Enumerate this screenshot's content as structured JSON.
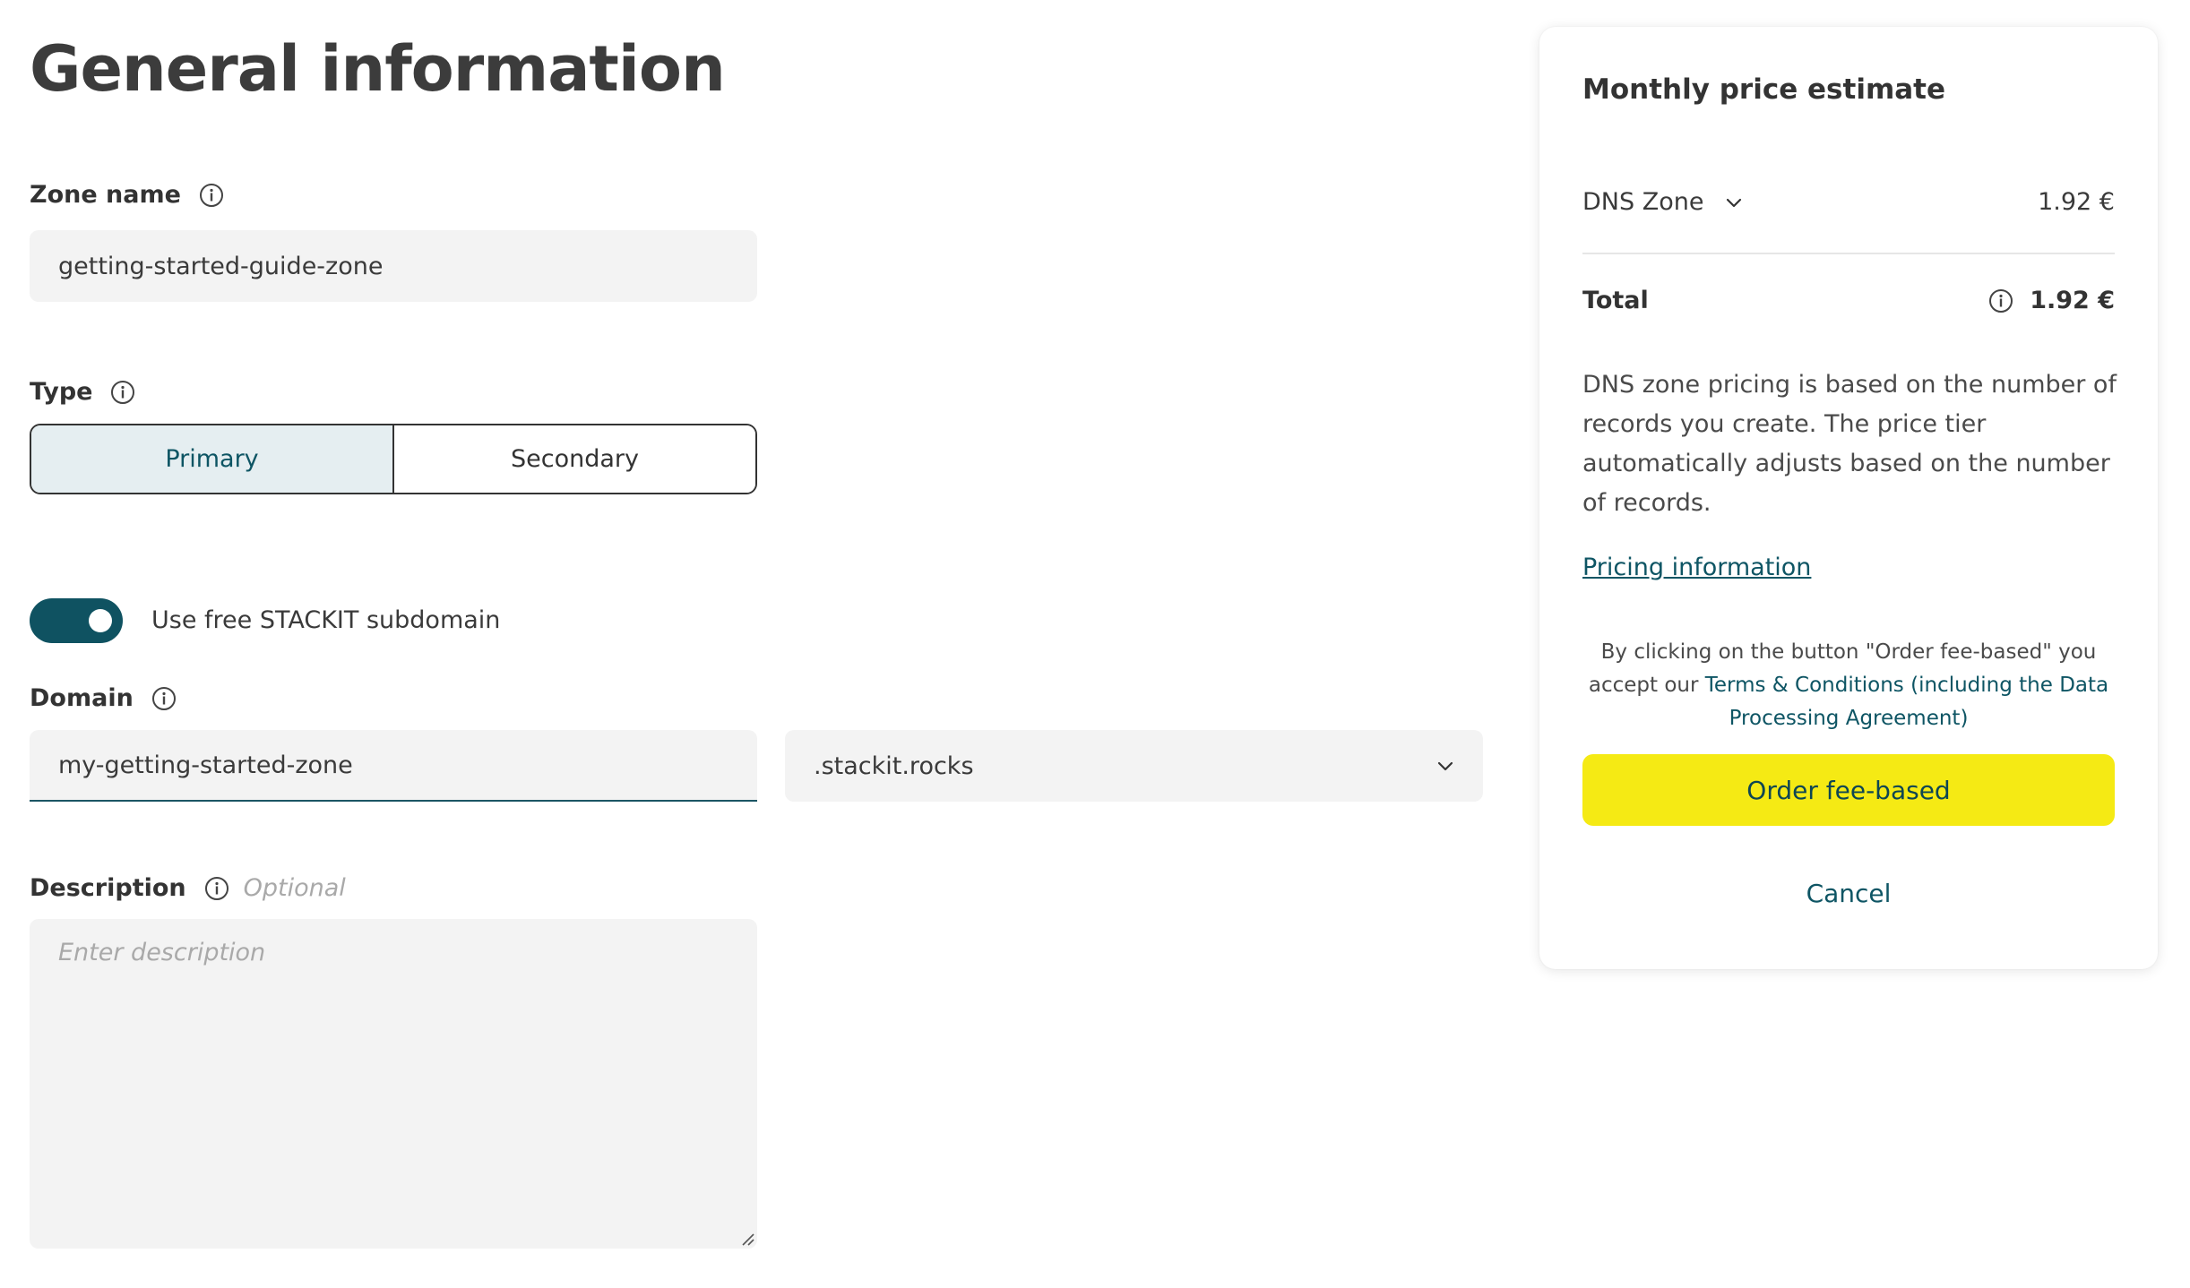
{
  "page": {
    "title": "General information"
  },
  "form": {
    "zone_name": {
      "label": "Zone name",
      "value": "getting-started-guide-zone"
    },
    "type": {
      "label": "Type",
      "options": [
        "Primary",
        "Secondary"
      ],
      "selected": "Primary"
    },
    "subdomain_toggle": {
      "label": "Use free STACKIT subdomain",
      "on": true
    },
    "domain": {
      "label": "Domain",
      "value": "my-getting-started-zone",
      "suffix": ".stackit.rocks"
    },
    "description": {
      "label": "Description",
      "optional_hint": "Optional",
      "placeholder": "Enter description"
    }
  },
  "price_card": {
    "title": "Monthly price estimate",
    "line_item": {
      "name": "DNS Zone",
      "price": "1.92 €"
    },
    "total": {
      "label": "Total",
      "value": "1.92 €"
    },
    "description": "DNS zone pricing is based on the number of records you create. The price tier automatically adjusts based on the number of records.",
    "pricing_link": "Pricing information",
    "terms_prefix": "By clicking on the button \"Order fee-based\" you accept our ",
    "terms_link": "Terms & Conditions (including the Data Processing Agreement)",
    "order_button": "Order fee-based",
    "cancel_button": "Cancel"
  },
  "colors": {
    "accent": "#0f5261",
    "order_button": "#f5ea14",
    "input_bg": "#f3f3f3",
    "segment_active_bg": "#e5eef1"
  },
  "icons": {
    "info": "info-circle-icon",
    "chevron": "chevron-down-icon",
    "resize": "resize-grip-icon"
  }
}
